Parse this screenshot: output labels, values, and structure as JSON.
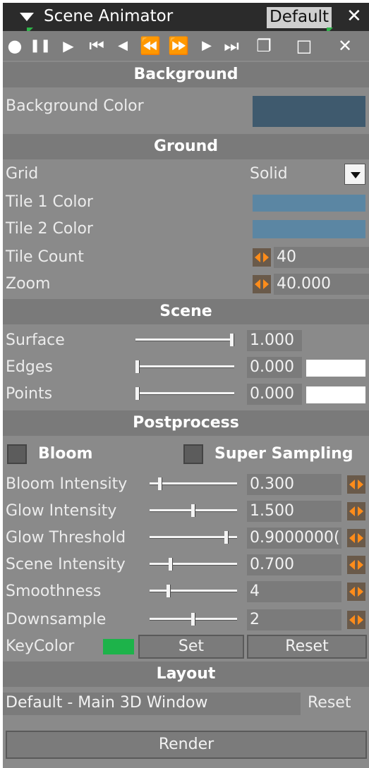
{
  "window": {
    "title": "Scene Animator",
    "preset": "Default",
    "close_glyph": "✕"
  },
  "toolbar": {
    "icons": [
      "record-icon",
      "pause-icon",
      "play-icon",
      "skip-to-start-icon",
      "step-back-icon",
      "rewind-icon",
      "fast-forward-icon",
      "step-forward-icon",
      "skip-to-end-icon",
      "restore-window-icon",
      "maximize-window-icon",
      "close-window-icon"
    ],
    "glyphs": [
      "●",
      "❚❚",
      "▶",
      "⏮",
      "◀",
      "⏪",
      "⏩",
      "▶",
      "⏭",
      "❐",
      "□",
      "✕"
    ]
  },
  "background": {
    "header": "Background",
    "color_label": "Background Color",
    "color": "#3f5a6e"
  },
  "ground": {
    "header": "Ground",
    "grid_label": "Grid",
    "grid_value": "Solid",
    "tile1_label": "Tile 1 Color",
    "tile1_color": "#5b86a3",
    "tile2_label": "Tile 2 Color",
    "tile2_color": "#5b86a3",
    "tile_count_label": "Tile Count",
    "tile_count": "40",
    "zoom_label": "Zoom",
    "zoom": "40.000"
  },
  "scene": {
    "header": "Scene",
    "surface_label": "Surface",
    "surface_value": "1.000",
    "surface_level": 1.0,
    "edges_label": "Edges",
    "edges_value": "0.000",
    "edges_level": 0.0,
    "edges_color": "#ffffff",
    "points_label": "Points",
    "points_value": "0.000",
    "points_level": 0.0,
    "points_color": "#ffffff"
  },
  "postprocess": {
    "header": "Postprocess",
    "bloom_label": "Bloom",
    "super_sampling_label": "Super Sampling",
    "bloom_intensity_label": "Bloom Intensity",
    "bloom_intensity": "0.300",
    "bloom_intensity_level": 0.1,
    "glow_intensity_label": "Glow Intensity",
    "glow_intensity": "1.500",
    "glow_intensity_level": 0.5,
    "glow_threshold_label": "Glow Threshold",
    "glow_threshold": "0.9000000(",
    "glow_threshold_level": 0.9,
    "scene_intensity_label": "Scene Intensity",
    "scene_intensity": "0.700",
    "scene_intensity_level": 0.23,
    "smoothness_label": "Smoothness",
    "smoothness": "4",
    "smoothness_level": 0.2,
    "downsample_label": "Downsample",
    "downsample": "2",
    "downsample_level": 0.5,
    "keycolor_label": "KeyColor",
    "keycolor": "#1db34a",
    "set_label": "Set",
    "reset_label": "Reset"
  },
  "layout": {
    "header": "Layout",
    "value": "Default - Main 3D Window",
    "reset_label": "Reset"
  },
  "render_label": "Render"
}
